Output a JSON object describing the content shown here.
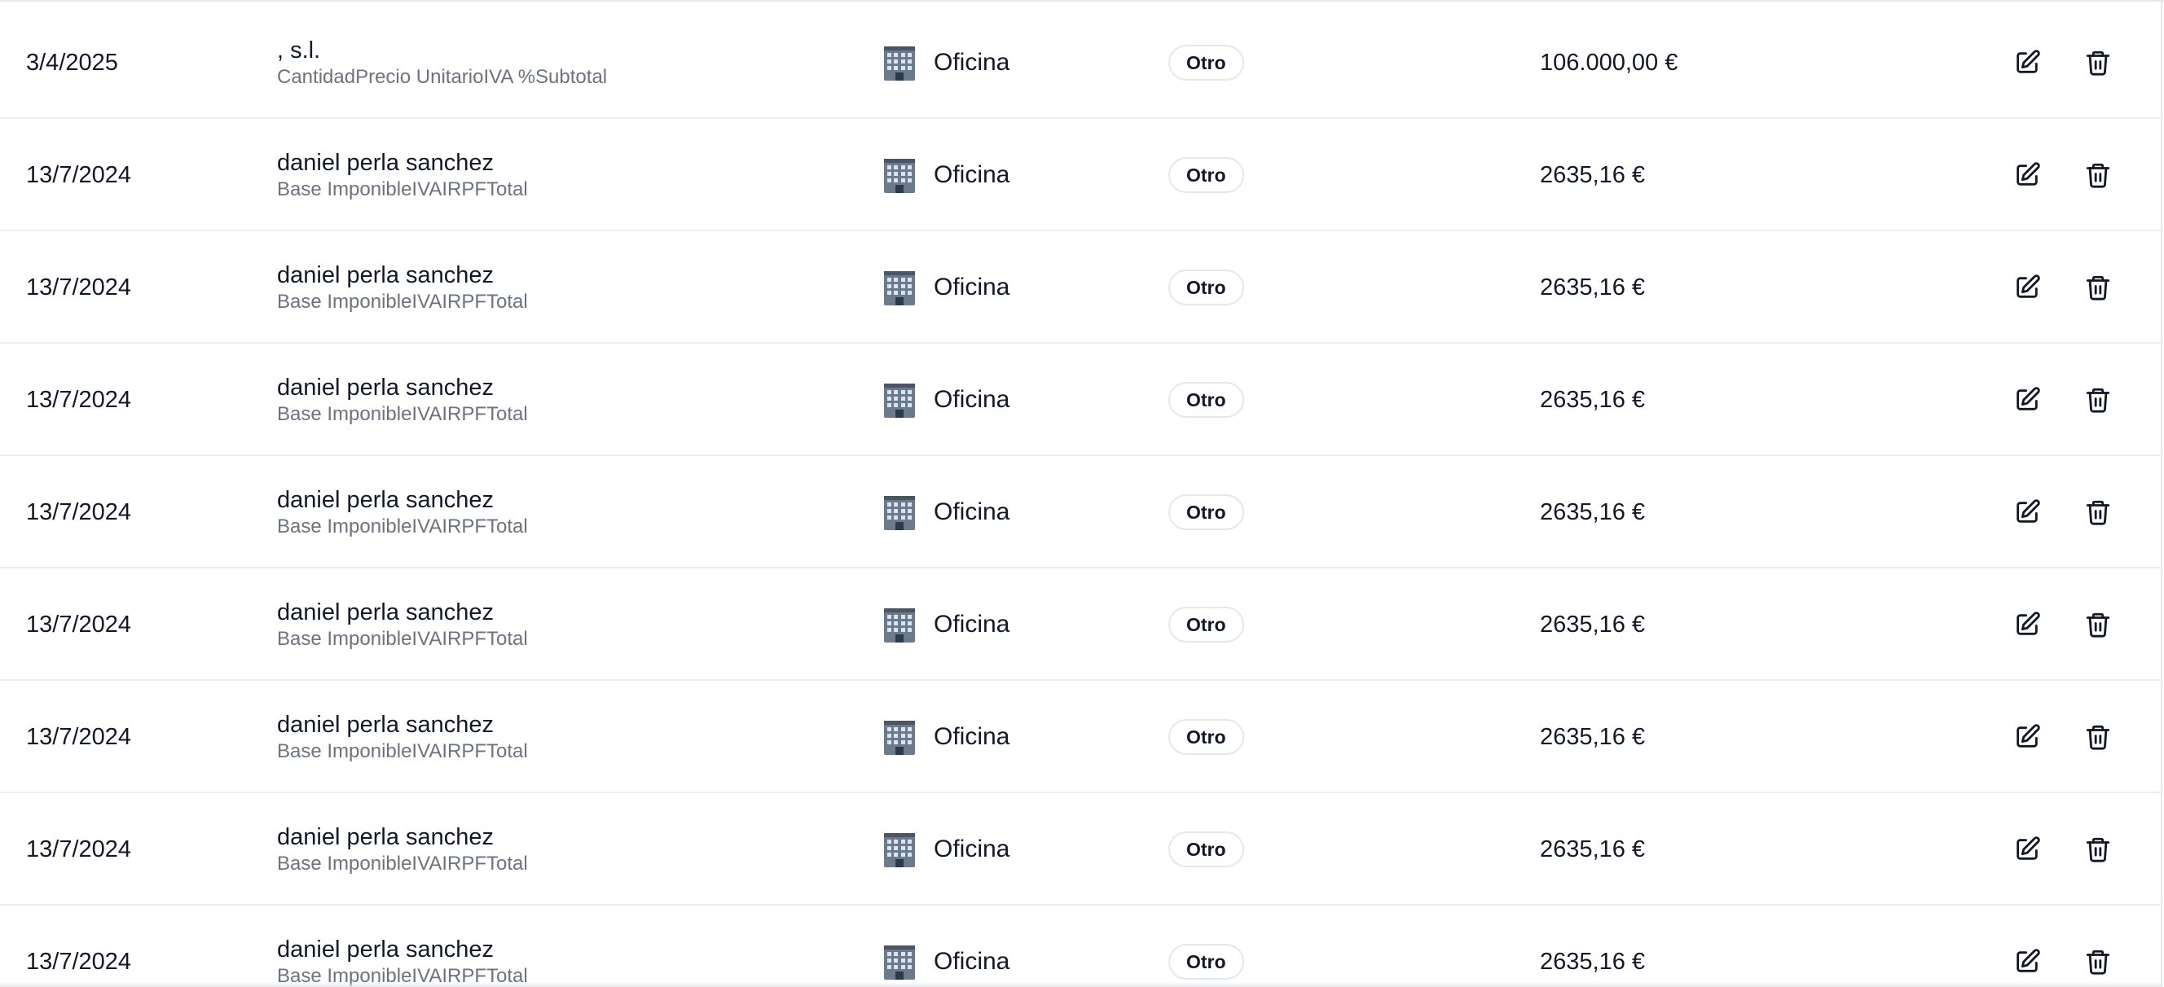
{
  "table": {
    "rows": [
      {
        "date": "3/4/2025",
        "client": ", s.l.",
        "description": "CantidadPrecio UnitarioIVA %Subtotal",
        "category": "Oficina",
        "type": "Otro",
        "amount": "106.000,00 €"
      },
      {
        "date": "13/7/2024",
        "client": "daniel perla sanchez",
        "description": "Base ImponibleIVAIRPFTotal",
        "category": "Oficina",
        "type": "Otro",
        "amount": "2635,16 €"
      },
      {
        "date": "13/7/2024",
        "client": "daniel perla sanchez",
        "description": "Base ImponibleIVAIRPFTotal",
        "category": "Oficina",
        "type": "Otro",
        "amount": "2635,16 €"
      },
      {
        "date": "13/7/2024",
        "client": "daniel perla sanchez",
        "description": "Base ImponibleIVAIRPFTotal",
        "category": "Oficina",
        "type": "Otro",
        "amount": "2635,16 €"
      },
      {
        "date": "13/7/2024",
        "client": "daniel perla sanchez",
        "description": "Base ImponibleIVAIRPFTotal",
        "category": "Oficina",
        "type": "Otro",
        "amount": "2635,16 €"
      },
      {
        "date": "13/7/2024",
        "client": "daniel perla sanchez",
        "description": "Base ImponibleIVAIRPFTotal",
        "category": "Oficina",
        "type": "Otro",
        "amount": "2635,16 €"
      },
      {
        "date": "13/7/2024",
        "client": "daniel perla sanchez",
        "description": "Base ImponibleIVAIRPFTotal",
        "category": "Oficina",
        "type": "Otro",
        "amount": "2635,16 €"
      },
      {
        "date": "13/7/2024",
        "client": "daniel perla sanchez",
        "description": "Base ImponibleIVAIRPFTotal",
        "category": "Oficina",
        "type": "Otro",
        "amount": "2635,16 €"
      },
      {
        "date": "13/7/2024",
        "client": "daniel perla sanchez",
        "description": "Base ImponibleIVAIRPFTotal",
        "category": "Oficina",
        "type": "Otro",
        "amount": "2635,16 €"
      }
    ],
    "icons": {
      "category": "office-building-icon",
      "edit": "edit-icon",
      "delete": "trash-icon"
    },
    "colors": {
      "text": "#111827",
      "muted": "#6b7280",
      "border": "#e5e7eb"
    }
  }
}
